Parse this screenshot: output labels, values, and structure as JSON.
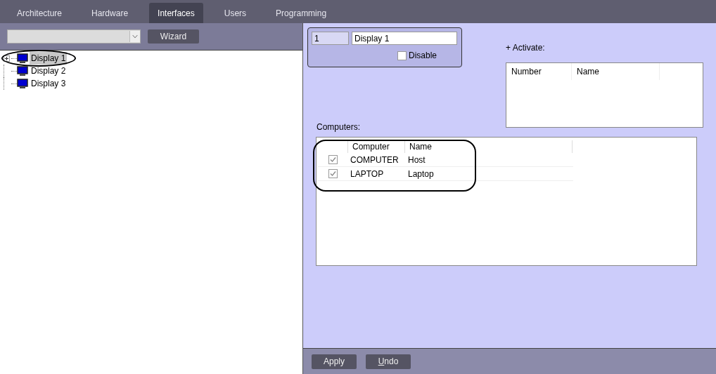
{
  "tabs": [
    {
      "label": "Architecture",
      "selected": false
    },
    {
      "label": "Hardware",
      "selected": false
    },
    {
      "label": "Interfaces",
      "selected": true
    },
    {
      "label": "Users",
      "selected": false
    },
    {
      "label": "Programming",
      "selected": false
    }
  ],
  "toolbar": {
    "wizard_button": "Wizard"
  },
  "tree": [
    {
      "label": "Display 1",
      "selected": true,
      "expanded": false,
      "highlighted": true
    },
    {
      "label": "Display 2",
      "selected": false,
      "highlighted": false
    },
    {
      "label": "Display 3",
      "selected": false,
      "highlighted": false
    }
  ],
  "object": {
    "number": "1",
    "name": "Display 1",
    "disable": {
      "label": "Disable",
      "checked": false
    }
  },
  "activate": {
    "label": "+ Activate:",
    "columns": [
      "Number",
      "Name"
    ]
  },
  "computers": {
    "label": "Computers:",
    "columns": [
      "Computer",
      "Name"
    ],
    "rows": [
      {
        "computer": "COMPUTER",
        "name": "Host",
        "checked": true
      },
      {
        "computer": "LAPTOP",
        "name": "Laptop",
        "checked": true
      }
    ],
    "highlighted": true
  },
  "buttons": [
    {
      "label": "Apply",
      "underline_first": false
    },
    {
      "label": "Undo",
      "underline_first": true
    }
  ]
}
